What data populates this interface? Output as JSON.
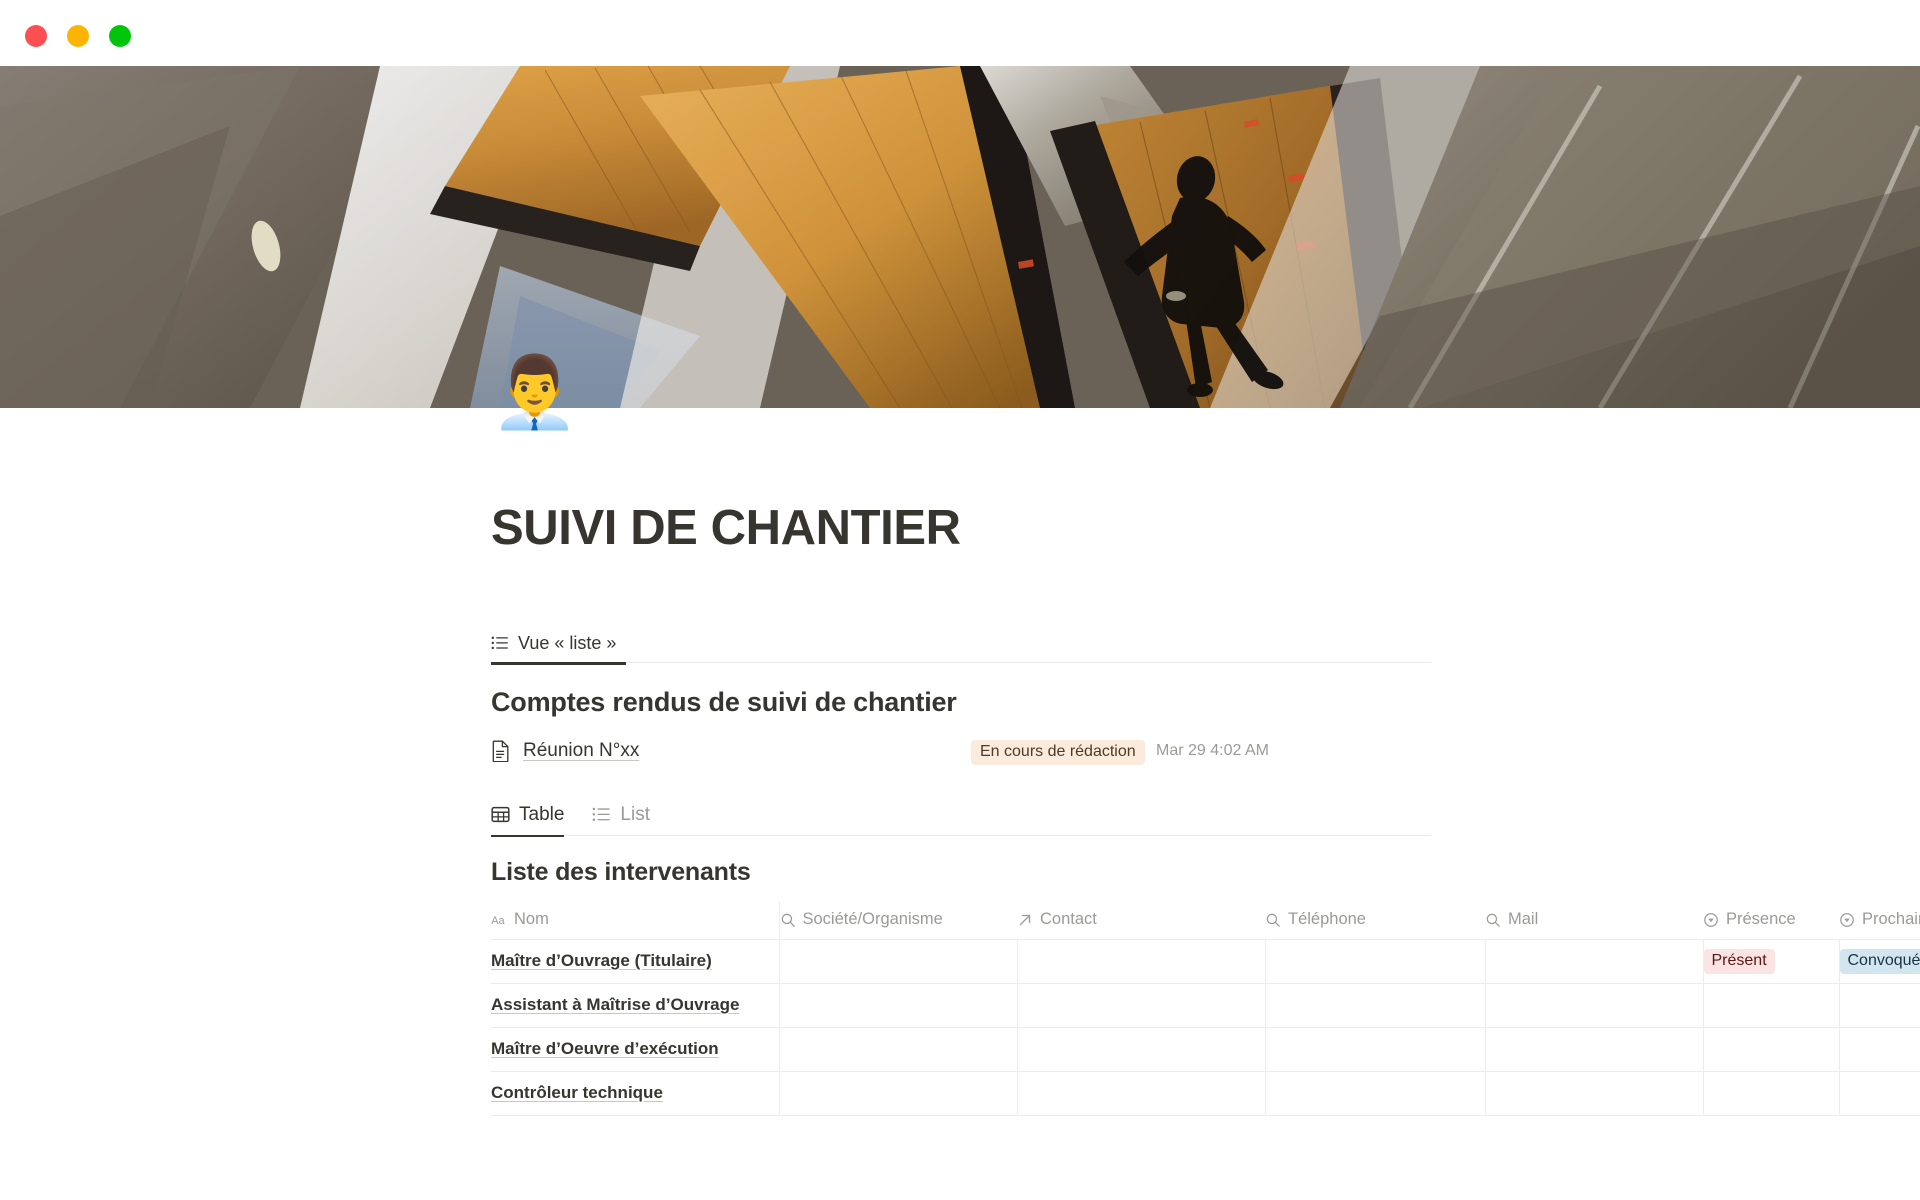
{
  "window": {
    "traffic_lights": [
      {
        "name": "close-button",
        "color": "#FC4F52"
      },
      {
        "name": "minimize-button",
        "color": "#FCB400"
      },
      {
        "name": "maximize-button",
        "color": "#00C50A"
      }
    ]
  },
  "cover": {
    "alt": "Architectural interior with curved wooden panels, polished metal and a silhouetted person walking"
  },
  "page": {
    "emoji": "👨‍💼",
    "emoji_name": "office-worker-emoji",
    "title": "SUIVI DE CHANTIER"
  },
  "view_tabs": [
    {
      "label": "Vue « liste »",
      "icon": "list-icon",
      "active": true
    }
  ],
  "list_section": {
    "heading": "Comptes rendus de suivi de chantier",
    "rows": [
      {
        "icon": "page-document-icon",
        "title": "Réunion N°xx",
        "status": "En cours de rédaction",
        "status_color": "#FAEBDD",
        "date": "Mar 29 4:02 AM"
      }
    ]
  },
  "db_tabs": [
    {
      "label": "Table",
      "icon": "table-icon",
      "active": true
    },
    {
      "label": "List",
      "icon": "list-icon",
      "active": false
    }
  ],
  "table_section": {
    "title": "Liste des intervenants",
    "columns": [
      {
        "label": "Nom",
        "icon": "text-aa-icon"
      },
      {
        "label": "Société/Organisme",
        "icon": "search-icon"
      },
      {
        "label": "Contact",
        "icon": "arrow-up-right-icon"
      },
      {
        "label": "Téléphone",
        "icon": "search-icon"
      },
      {
        "label": "Mail",
        "icon": "search-icon"
      },
      {
        "label": "Présence",
        "icon": "select-chevron-icon"
      },
      {
        "label": "Prochaine réuni..",
        "icon": "select-chevron-icon"
      }
    ],
    "rows": [
      {
        "nom": "Maître d’Ouvrage (Titulaire)",
        "societe": "",
        "contact": "",
        "telephone": "",
        "mail": "",
        "presence": "Présent",
        "presence_color": "#FBE4E4",
        "prochaine": "Convoqué",
        "prochaine_color": "#D3E5EF"
      },
      {
        "nom": "Assistant à Maîtrise d’Ouvrage",
        "societe": "",
        "contact": "",
        "telephone": "",
        "mail": "",
        "presence": "",
        "presence_color": "",
        "prochaine": "",
        "prochaine_color": ""
      },
      {
        "nom": "Maître d’Oeuvre d’exécution",
        "societe": "",
        "contact": "",
        "telephone": "",
        "mail": "",
        "presence": "",
        "presence_color": "",
        "prochaine": "",
        "prochaine_color": ""
      },
      {
        "nom": "Contrôleur technique",
        "societe": "",
        "contact": "",
        "telephone": "",
        "mail": "",
        "presence": "",
        "presence_color": "",
        "prochaine": "",
        "prochaine_color": ""
      }
    ]
  },
  "colors": {
    "text_primary": "#37352F",
    "text_muted": "#9B9A97",
    "border": "#EDEDEC",
    "tag_pink": "#FBE4E4",
    "tag_blue": "#D3E5EF",
    "tag_orange": "#FAEBDD"
  }
}
